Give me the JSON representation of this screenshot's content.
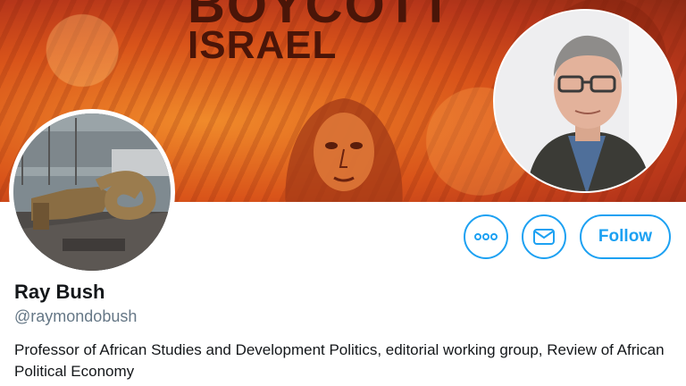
{
  "banner": {
    "title_line1": "BOYCOTT",
    "title_line2": "ISRAEL"
  },
  "profile": {
    "display_name": "Ray Bush",
    "handle": "@raymondobush",
    "bio": "Professor of African Studies and Development Politics, editorial working group, Review of African Political Economy"
  },
  "actions": {
    "more_icon": "more-icon",
    "message_icon": "envelope-icon",
    "follow_label": "Follow"
  },
  "colors": {
    "accent": "#1da1f2",
    "banner": "#d9541a",
    "handle": "#657786",
    "text": "#14171a"
  }
}
